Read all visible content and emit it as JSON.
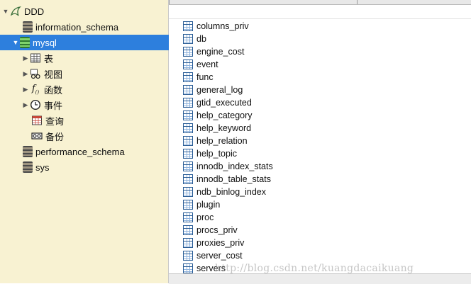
{
  "tree": {
    "root": {
      "label": "DDD"
    },
    "databases": [
      {
        "label": "information_schema"
      },
      {
        "label": "mysql",
        "selected": true
      },
      {
        "label": "performance_schema"
      },
      {
        "label": "sys"
      }
    ],
    "mysql_children": [
      {
        "label": "表",
        "icon": "table-grid-icon"
      },
      {
        "label": "视图",
        "icon": "glasses-icon"
      },
      {
        "label": "函数",
        "icon": "function-fx-icon"
      },
      {
        "label": "事件",
        "icon": "clock-icon"
      },
      {
        "label": "查询",
        "icon": "query-icon"
      },
      {
        "label": "备份",
        "icon": "tape-backup-icon"
      }
    ]
  },
  "tables": [
    "columns_priv",
    "db",
    "engine_cost",
    "event",
    "func",
    "general_log",
    "gtid_executed",
    "help_category",
    "help_keyword",
    "help_relation",
    "help_topic",
    "innodb_index_stats",
    "innodb_table_stats",
    "ndb_binlog_index",
    "plugin",
    "proc",
    "procs_priv",
    "proxies_priv",
    "server_cost",
    "servers"
  ],
  "watermark": "http://blog.csdn.net/kuangdacaikuang",
  "colors": {
    "sidebar_bg": "#f8f2d2",
    "selection": "#2d7fdd",
    "table_icon": "#2a5d96"
  }
}
